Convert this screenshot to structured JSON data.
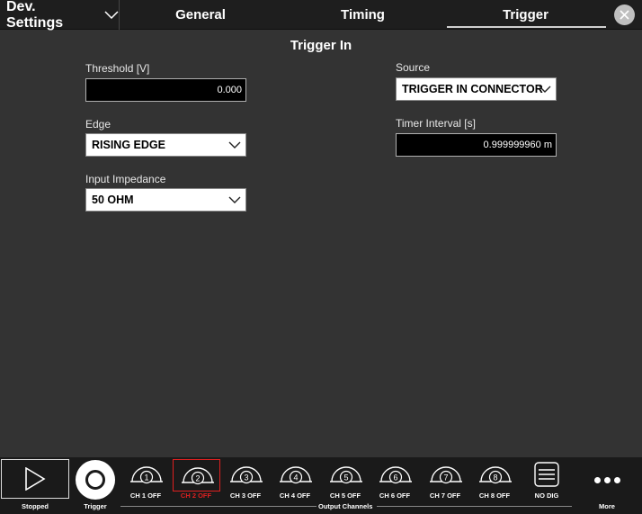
{
  "header": {
    "dev_settings_label": "Dev. Settings",
    "tabs": [
      {
        "label": "General"
      },
      {
        "label": "Timing"
      },
      {
        "label": "Trigger",
        "active": true
      }
    ]
  },
  "panel": {
    "title": "Trigger In",
    "threshold": {
      "label": "Threshold [V]",
      "value": "0.000"
    },
    "edge": {
      "label": "Edge",
      "value": "RISING EDGE"
    },
    "impedance": {
      "label": "Input Impedance",
      "value": "50 OHM"
    },
    "source": {
      "label": "Source",
      "value": "TRIGGER IN CONNECTOR"
    },
    "timer": {
      "label": "Timer Interval [s]",
      "value": "0.999999960 m"
    }
  },
  "bottombar": {
    "stopped_label": "Stopped",
    "trigger_label": "Trigger",
    "channels": [
      {
        "num": "1",
        "label": "CH 1 OFF"
      },
      {
        "num": "2",
        "label": "CH 2 OFF",
        "selected": true
      },
      {
        "num": "3",
        "label": "CH 3 OFF"
      },
      {
        "num": "4",
        "label": "CH 4 OFF"
      },
      {
        "num": "5",
        "label": "CH 5 OFF"
      },
      {
        "num": "6",
        "label": "CH 6 OFF"
      },
      {
        "num": "7",
        "label": "CH 7 OFF"
      },
      {
        "num": "8",
        "label": "CH 8 OFF"
      }
    ],
    "nodig_label": "NO DIG",
    "group_label": "Output Channels",
    "more_label": "More"
  },
  "colors": {
    "background": "#333333",
    "bar": "#1a1a1a",
    "selected_accent": "#e02020"
  }
}
